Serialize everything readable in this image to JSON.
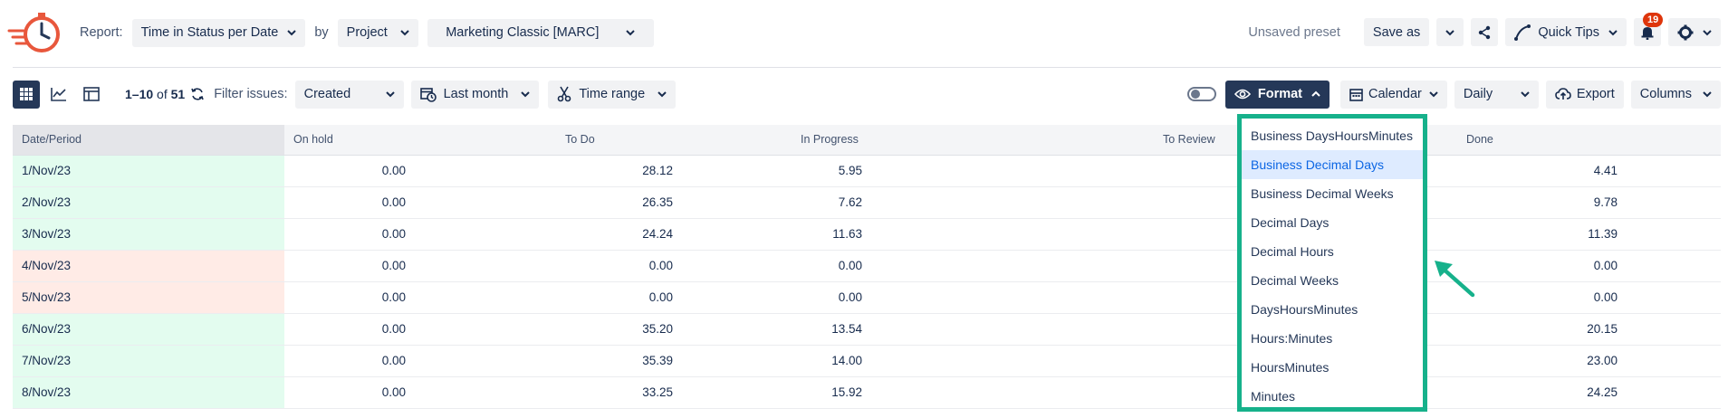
{
  "header": {
    "report_label": "Report:",
    "report_value": "Time in Status per Date",
    "by_label": "by",
    "by_value": "Project",
    "project_value": "Marketing Classic [MARC]",
    "unsaved": "Unsaved preset",
    "save_as": "Save as",
    "quick_tips": "Quick Tips",
    "notifications": "19"
  },
  "toolbar": {
    "range": "1–10",
    "of": "of",
    "total": "51",
    "filter_label": "Filter issues:",
    "filter_value": "Created",
    "date_value": "Last month",
    "time_range": "Time range",
    "format": "Format",
    "calendar": "Calendar",
    "granularity": "Daily",
    "export": "Export",
    "columns": "Columns"
  },
  "table": {
    "headers": [
      "Date/Period",
      "On hold",
      "To Do",
      "In Progress",
      "To Review",
      "Done"
    ],
    "rows": [
      {
        "date": "1/Nov/23",
        "on_hold": "0.00",
        "todo": "28.12",
        "in_progress": "5.95",
        "done": "4.41",
        "status": "green"
      },
      {
        "date": "2/Nov/23",
        "on_hold": "0.00",
        "todo": "26.35",
        "in_progress": "7.62",
        "done": "9.78",
        "status": "green"
      },
      {
        "date": "3/Nov/23",
        "on_hold": "0.00",
        "todo": "24.24",
        "in_progress": "11.63",
        "done": "11.39",
        "status": "green"
      },
      {
        "date": "4/Nov/23",
        "on_hold": "0.00",
        "todo": "0.00",
        "in_progress": "0.00",
        "done": "0.00",
        "status": "red"
      },
      {
        "date": "5/Nov/23",
        "on_hold": "0.00",
        "todo": "0.00",
        "in_progress": "0.00",
        "done": "0.00",
        "status": "red"
      },
      {
        "date": "6/Nov/23",
        "on_hold": "0.00",
        "todo": "35.20",
        "in_progress": "13.54",
        "done": "20.15",
        "status": "green"
      },
      {
        "date": "7/Nov/23",
        "on_hold": "0.00",
        "todo": "35.39",
        "in_progress": "14.00",
        "done": "23.00",
        "status": "green"
      },
      {
        "date": "8/Nov/23",
        "on_hold": "0.00",
        "todo": "33.25",
        "in_progress": "15.92",
        "done": "24.25",
        "status": "green"
      }
    ]
  },
  "format_menu": {
    "items": [
      "Business DaysHoursMinutes",
      "Business Decimal Days",
      "Business Decimal Weeks",
      "Decimal Days",
      "Decimal Hours",
      "Decimal Weeks",
      "DaysHoursMinutes",
      "Hours:Minutes",
      "HoursMinutes",
      "Minutes"
    ],
    "selected": "Business Decimal Days"
  },
  "colors": {
    "accent_dark": "#253858",
    "highlight_border": "#16b18b",
    "selected_bg": "#deebff",
    "weekday_bg": "#e3fcef",
    "weekend_bg": "#ffebe6",
    "badge": "#de350b"
  },
  "icons": [
    "stopwatch-logo-icon",
    "chevron-down-icon",
    "share-icon",
    "quick-tips-icon",
    "bell-icon",
    "gear-icon",
    "grid-view-icon",
    "line-chart-icon",
    "layout-icon",
    "refresh-icon",
    "calendar-clock-icon",
    "scissors-icon",
    "toggle-icon",
    "eye-icon",
    "chevron-up-icon",
    "calendar-icon",
    "cloud-upload-icon",
    "arrow-icon"
  ]
}
